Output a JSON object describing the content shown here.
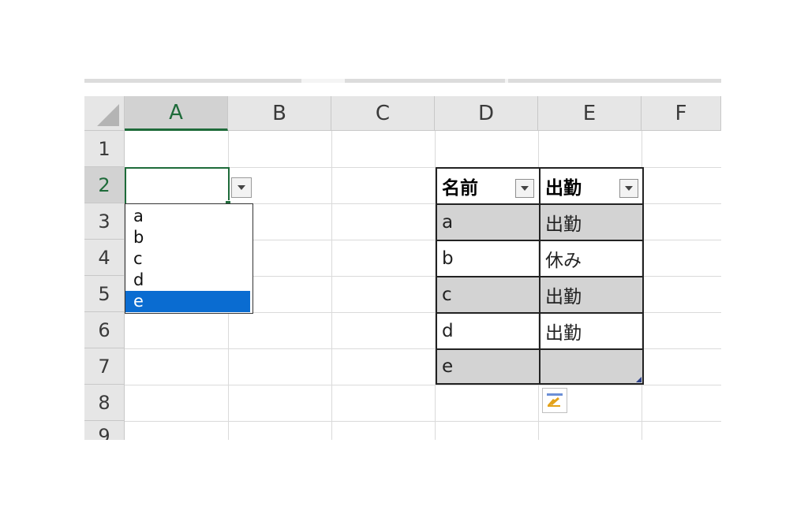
{
  "columns": [
    "A",
    "B",
    "C",
    "D",
    "E",
    "F"
  ],
  "rows": [
    "1",
    "2",
    "3",
    "4",
    "5",
    "6",
    "7",
    "8",
    "9"
  ],
  "dropdown": {
    "options": [
      "a",
      "b",
      "c",
      "d",
      "e"
    ],
    "highlighted": "e"
  },
  "table": {
    "headers": [
      "名前",
      "出勤"
    ],
    "rows": [
      [
        "a",
        "出勤"
      ],
      [
        "b",
        "休み"
      ],
      [
        "c",
        "出勤"
      ],
      [
        "d",
        "出勤"
      ],
      [
        "e",
        ""
      ]
    ]
  },
  "icons": {
    "dropdown_arrow": "chevron-down-icon",
    "filter": "filter-dropdown-icon",
    "quick_analysis": "quick-analysis-icon"
  },
  "colors": {
    "selected_green": "#1e6b3a",
    "highlight_blue": "#0a6cd1",
    "banded_gray": "#d3d3d3",
    "header_gray": "#e6e6e6"
  }
}
